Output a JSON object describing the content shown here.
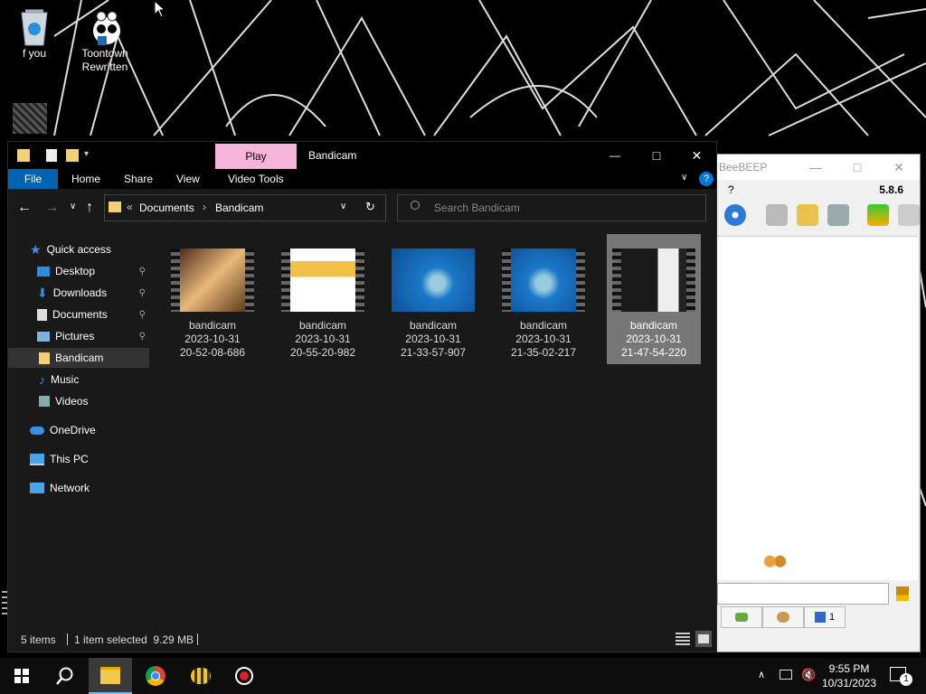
{
  "desktop": {
    "icons": [
      {
        "label": "f you",
        "icon": "recycle-bin-icon"
      },
      {
        "label": "Toontown Rewritten",
        "icon": "toontown-icon"
      }
    ]
  },
  "beebeep": {
    "title": "BeeBEEP",
    "menu_help": "?",
    "version": "5.8.6",
    "tab_count": "1"
  },
  "explorer": {
    "quick_toolbar": [
      "folder-icon",
      "properties-icon",
      "new-folder-icon",
      "customize-dropdown-icon"
    ],
    "contextual_tab": "Play",
    "title": "Bandicam",
    "ribbon_tabs": [
      "File",
      "Home",
      "Share",
      "View",
      "Video Tools"
    ],
    "breadcrumb": {
      "overflow": "«",
      "items": [
        "Documents",
        "Bandicam"
      ]
    },
    "search_placeholder": "Search Bandicam",
    "nav": {
      "quick_access": "Quick access",
      "items": [
        "Desktop",
        "Downloads",
        "Documents",
        "Pictures",
        "Bandicam",
        "Music",
        "Videos"
      ],
      "onedrive": "OneDrive",
      "thispc": "This PC",
      "network": "Network"
    },
    "files": [
      {
        "name": "bandicam",
        "date": "2023-10-31",
        "time": "20-52-08-686",
        "selected": false
      },
      {
        "name": "bandicam",
        "date": "2023-10-31",
        "time": "20-55-20-982",
        "selected": false
      },
      {
        "name": "bandicam",
        "date": "2023-10-31",
        "time": "21-33-57-907",
        "selected": false
      },
      {
        "name": "bandicam",
        "date": "2023-10-31",
        "time": "21-35-02-217",
        "selected": false
      },
      {
        "name": "bandicam",
        "date": "2023-10-31",
        "time": "21-47-54-220",
        "selected": true
      }
    ],
    "status": {
      "count": "5 items",
      "selection": "1 item selected  9.29 MB"
    }
  },
  "taskbar": {
    "time": "9:55 PM",
    "date": "10/31/2023",
    "notification_count": "1"
  },
  "colors": {
    "accent": "#0063b1",
    "play_tab": "#f6b4d8"
  }
}
